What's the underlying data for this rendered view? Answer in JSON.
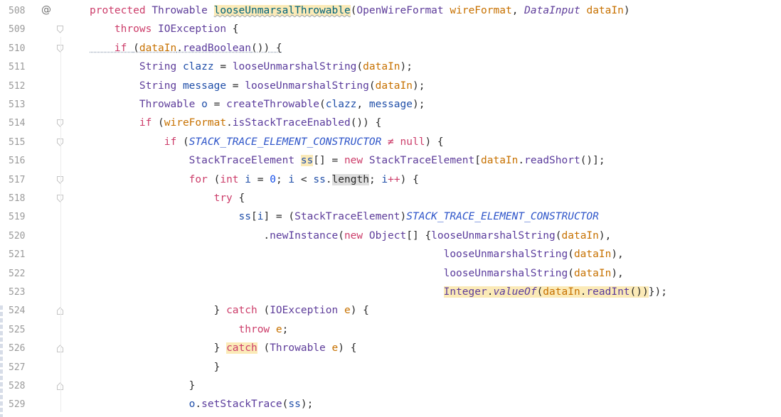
{
  "editor": {
    "lines": [
      {
        "number": "508",
        "mark": "@",
        "fold": "none",
        "tokens": [
          {
            "t": "protected ",
            "c": "kw2"
          },
          {
            "t": "Throwable ",
            "c": "ty"
          },
          {
            "t": "looseUnmarsalThrowable",
            "c": "fn hl-yellow squig"
          },
          {
            "t": "(",
            "c": "pl"
          },
          {
            "t": "OpenWireFormat ",
            "c": "ty"
          },
          {
            "t": "wireFormat",
            "c": "var"
          },
          {
            "t": ", ",
            "c": "pl"
          },
          {
            "t": "DataInput ",
            "c": "ty ital"
          },
          {
            "t": "dataIn",
            "c": "var"
          },
          {
            "t": ")",
            "c": "pl"
          }
        ]
      },
      {
        "number": "509",
        "mark": "",
        "fold": "down",
        "tokens": [
          {
            "t": "    throws ",
            "c": "kw2"
          },
          {
            "t": "IOException ",
            "c": "ty"
          },
          {
            "t": "{",
            "c": "pl"
          }
        ]
      },
      {
        "number": "510",
        "mark": "",
        "fold": "down",
        "tokens": [
          {
            "t": "    if ",
            "c": "kw2 squig2"
          },
          {
            "t": "(",
            "c": "pl squig2"
          },
          {
            "t": "dataIn",
            "c": "var squig2"
          },
          {
            "t": ".",
            "c": "pl squig2"
          },
          {
            "t": "readBoolean",
            "c": "call squig2"
          },
          {
            "t": "()) {",
            "c": "pl squig2"
          }
        ]
      },
      {
        "number": "511",
        "mark": "",
        "fold": "none",
        "tokens": [
          {
            "t": "        String ",
            "c": "ty"
          },
          {
            "t": "clazz ",
            "c": "local"
          },
          {
            "t": "= ",
            "c": "pl"
          },
          {
            "t": "looseUnmarshalString",
            "c": "call"
          },
          {
            "t": "(",
            "c": "pl"
          },
          {
            "t": "dataIn",
            "c": "var"
          },
          {
            "t": ");",
            "c": "pl"
          }
        ]
      },
      {
        "number": "512",
        "mark": "",
        "fold": "none",
        "tokens": [
          {
            "t": "        String ",
            "c": "ty"
          },
          {
            "t": "message ",
            "c": "local"
          },
          {
            "t": "= ",
            "c": "pl"
          },
          {
            "t": "looseUnmarshalString",
            "c": "call"
          },
          {
            "t": "(",
            "c": "pl"
          },
          {
            "t": "dataIn",
            "c": "var"
          },
          {
            "t": ");",
            "c": "pl"
          }
        ]
      },
      {
        "number": "513",
        "mark": "",
        "fold": "none",
        "tokens": [
          {
            "t": "        Throwable ",
            "c": "ty"
          },
          {
            "t": "o ",
            "c": "local"
          },
          {
            "t": "= ",
            "c": "pl"
          },
          {
            "t": "createThrowable",
            "c": "call"
          },
          {
            "t": "(",
            "c": "pl"
          },
          {
            "t": "clazz",
            "c": "local"
          },
          {
            "t": ", ",
            "c": "pl"
          },
          {
            "t": "message",
            "c": "local"
          },
          {
            "t": ");",
            "c": "pl"
          }
        ]
      },
      {
        "number": "514",
        "mark": "",
        "fold": "down",
        "tokens": [
          {
            "t": "        if ",
            "c": "kw2"
          },
          {
            "t": "(",
            "c": "pl"
          },
          {
            "t": "wireFormat",
            "c": "var"
          },
          {
            "t": ".",
            "c": "pl"
          },
          {
            "t": "isStackTraceEnabled",
            "c": "call"
          },
          {
            "t": "()) {",
            "c": "pl"
          }
        ]
      },
      {
        "number": "515",
        "mark": "",
        "fold": "down",
        "tokens": [
          {
            "t": "            if ",
            "c": "kw2"
          },
          {
            "t": "(",
            "c": "pl"
          },
          {
            "t": "STACK_TRACE_ELEMENT_CONSTRUCTOR ",
            "c": "const"
          },
          {
            "t": "≠ ",
            "c": "kw2"
          },
          {
            "t": "null",
            "c": "kw2"
          },
          {
            "t": ") {",
            "c": "pl"
          }
        ]
      },
      {
        "number": "516",
        "mark": "",
        "fold": "none",
        "tokens": [
          {
            "t": "                StackTraceElement ",
            "c": "ty"
          },
          {
            "t": "ss",
            "c": "local hl-yellow"
          },
          {
            "t": "[] = ",
            "c": "pl"
          },
          {
            "t": "new ",
            "c": "kw2"
          },
          {
            "t": "StackTraceElement",
            "c": "ty"
          },
          {
            "t": "[",
            "c": "pl"
          },
          {
            "t": "dataIn",
            "c": "var"
          },
          {
            "t": ".",
            "c": "pl"
          },
          {
            "t": "readShort",
            "c": "call"
          },
          {
            "t": "()];",
            "c": "pl"
          }
        ]
      },
      {
        "number": "517",
        "mark": "",
        "fold": "down",
        "tokens": [
          {
            "t": "                for ",
            "c": "kw2"
          },
          {
            "t": "(",
            "c": "pl"
          },
          {
            "t": "int ",
            "c": "kw2"
          },
          {
            "t": "i ",
            "c": "local"
          },
          {
            "t": "= ",
            "c": "pl"
          },
          {
            "t": "0",
            "c": "num"
          },
          {
            "t": "; ",
            "c": "pl"
          },
          {
            "t": "i ",
            "c": "local"
          },
          {
            "t": "< ",
            "c": "pl"
          },
          {
            "t": "ss",
            "c": "local"
          },
          {
            "t": ".",
            "c": "pl"
          },
          {
            "t": "length",
            "c": "pl hl-gray"
          },
          {
            "t": "; ",
            "c": "pl"
          },
          {
            "t": "i",
            "c": "local"
          },
          {
            "t": "++",
            "c": "kw2"
          },
          {
            "t": ") {",
            "c": "pl"
          }
        ]
      },
      {
        "number": "518",
        "mark": "",
        "fold": "down",
        "tokens": [
          {
            "t": "                    try ",
            "c": "kw2"
          },
          {
            "t": "{",
            "c": "pl"
          }
        ]
      },
      {
        "number": "519",
        "mark": "",
        "fold": "none",
        "tokens": [
          {
            "t": "                        ss",
            "c": "local"
          },
          {
            "t": "[",
            "c": "pl"
          },
          {
            "t": "i",
            "c": "local"
          },
          {
            "t": "] = (",
            "c": "pl"
          },
          {
            "t": "StackTraceElement",
            "c": "ty"
          },
          {
            "t": ")",
            "c": "pl"
          },
          {
            "t": "STACK_TRACE_ELEMENT_CONSTRUCTOR",
            "c": "const"
          }
        ]
      },
      {
        "number": "520",
        "mark": "",
        "fold": "none",
        "tokens": [
          {
            "t": "                            .",
            "c": "pl"
          },
          {
            "t": "newInstance",
            "c": "call"
          },
          {
            "t": "(",
            "c": "pl"
          },
          {
            "t": "new ",
            "c": "kw2"
          },
          {
            "t": "Object",
            "c": "ty"
          },
          {
            "t": "[] {",
            "c": "pl"
          },
          {
            "t": "looseUnmarshalString",
            "c": "call"
          },
          {
            "t": "(",
            "c": "pl"
          },
          {
            "t": "dataIn",
            "c": "var"
          },
          {
            "t": "),",
            "c": "pl"
          }
        ]
      },
      {
        "number": "521",
        "mark": "",
        "fold": "none",
        "tokens": [
          {
            "t": "                                                         looseUnmarshalString",
            "c": "call"
          },
          {
            "t": "(",
            "c": "pl"
          },
          {
            "t": "dataIn",
            "c": "var"
          },
          {
            "t": "),",
            "c": "pl"
          }
        ]
      },
      {
        "number": "522",
        "mark": "",
        "fold": "none",
        "tokens": [
          {
            "t": "                                                         looseUnmarshalString",
            "c": "call"
          },
          {
            "t": "(",
            "c": "pl"
          },
          {
            "t": "dataIn",
            "c": "var"
          },
          {
            "t": "),",
            "c": "pl"
          }
        ]
      },
      {
        "number": "523",
        "mark": "",
        "fold": "none",
        "tokens": [
          {
            "t": "                                                         ",
            "c": "pl"
          },
          {
            "t": "Integer",
            "c": "ty hl-yellow"
          },
          {
            "t": ".",
            "c": "pl hl-yellow"
          },
          {
            "t": "valueOf",
            "c": "call ital hl-yellow"
          },
          {
            "t": "(",
            "c": "pl hl-yellow"
          },
          {
            "t": "dataIn",
            "c": "var hl-yellow"
          },
          {
            "t": ".",
            "c": "pl hl-yellow"
          },
          {
            "t": "readInt",
            "c": "call hl-yellow"
          },
          {
            "t": "())",
            "c": "pl hl-yellow"
          },
          {
            "t": "});",
            "c": "pl"
          }
        ]
      },
      {
        "number": "524",
        "mark": "",
        "fold": "up",
        "tokens": [
          {
            "t": "                    } ",
            "c": "pl"
          },
          {
            "t": "catch ",
            "c": "kw2"
          },
          {
            "t": "(",
            "c": "pl"
          },
          {
            "t": "IOException ",
            "c": "ty"
          },
          {
            "t": "e",
            "c": "var"
          },
          {
            "t": ") {",
            "c": "pl"
          }
        ]
      },
      {
        "number": "525",
        "mark": "",
        "fold": "none",
        "tokens": [
          {
            "t": "                        throw ",
            "c": "kw2"
          },
          {
            "t": "e",
            "c": "var"
          },
          {
            "t": ";",
            "c": "pl"
          }
        ]
      },
      {
        "number": "526",
        "mark": "",
        "fold": "up",
        "tokens": [
          {
            "t": "                    } ",
            "c": "pl"
          },
          {
            "t": "catch",
            "c": "kw2 hl-yellow"
          },
          {
            "t": " (",
            "c": "pl"
          },
          {
            "t": "Throwable ",
            "c": "ty"
          },
          {
            "t": "e",
            "c": "var"
          },
          {
            "t": ") {",
            "c": "pl"
          }
        ]
      },
      {
        "number": "527",
        "mark": "",
        "fold": "none",
        "tokens": [
          {
            "t": "                    }",
            "c": "pl"
          }
        ]
      },
      {
        "number": "528",
        "mark": "",
        "fold": "up",
        "tokens": [
          {
            "t": "                }",
            "c": "pl"
          }
        ]
      },
      {
        "number": "529",
        "mark": "",
        "fold": "none",
        "tokens": [
          {
            "t": "                o",
            "c": "local"
          },
          {
            "t": ".",
            "c": "pl"
          },
          {
            "t": "setStackTrace",
            "c": "call"
          },
          {
            "t": "(",
            "c": "pl"
          },
          {
            "t": "ss",
            "c": "local"
          },
          {
            "t": ");",
            "c": "pl"
          }
        ]
      }
    ]
  }
}
